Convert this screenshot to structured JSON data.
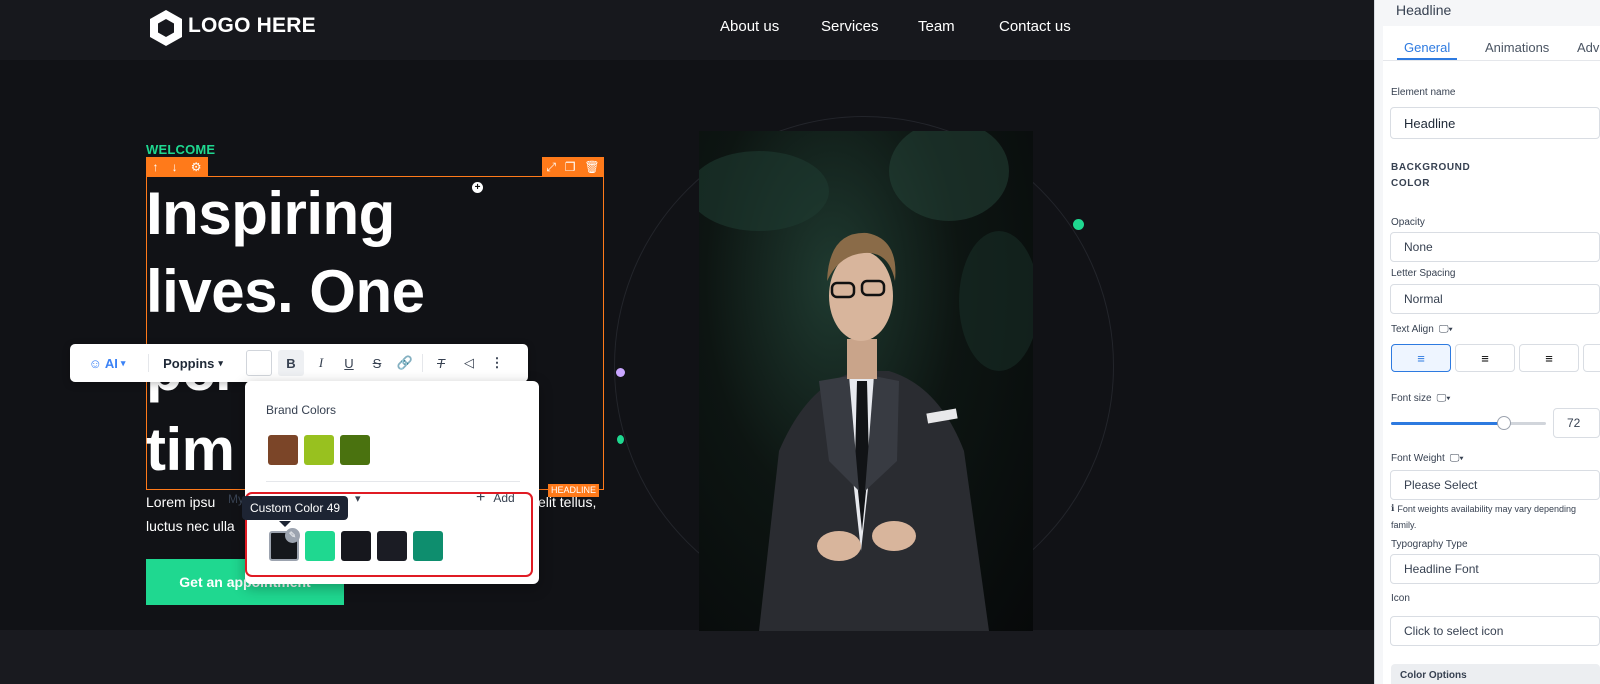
{
  "navbar": {
    "logo_text": "LOGO HERE",
    "links": [
      "About us",
      "Services",
      "Team",
      "Contact us"
    ]
  },
  "hero": {
    "welcome": "WELCOME",
    "headline_lines": [
      "Inspiring",
      "lives. One",
      "per",
      "tim"
    ],
    "element_tag": "HEADLINE",
    "lorem_line1_left": "Lorem ipsu",
    "lorem_line1_right": "elit tellus,",
    "lorem_line2": "luctus nec ulla",
    "cta_label": "Get an appointment"
  },
  "text_toolbar": {
    "ai_label": "AI",
    "font_label": "Poppins"
  },
  "color_popup": {
    "brand_heading": "Brand Colors",
    "brand_colors": [
      "#7b4528",
      "#98c11f",
      "#4a720f"
    ],
    "custom_label_partial": "My",
    "tooltip": "Custom Color 49",
    "add_label": "Add",
    "custom_colors": [
      "#15171c",
      "#1fd890",
      "#16171d",
      "#1b1c24",
      "#0e8e6e"
    ]
  },
  "panel": {
    "title": "Headline",
    "tabs": [
      "General",
      "Animations",
      "Adv"
    ],
    "active_tab": "General",
    "element_name_label": "Element name",
    "element_name_value": "Headline",
    "background_color_label": "BACKGROUND COLOR",
    "opacity_label": "Opacity",
    "opacity_value": "None",
    "letter_spacing_label": "Letter Spacing",
    "letter_spacing_value": "Normal",
    "text_align_label": "Text Align",
    "font_size_label": "Font size",
    "font_size_value": "72",
    "font_size_fraction": 0.73,
    "font_weight_label": "Font Weight",
    "font_weight_placeholder": "Please Select",
    "font_weight_note": "Font weights availability may vary depending",
    "font_weight_note2": "family.",
    "typography_label": "Typography Type",
    "typography_value": "Headline Font",
    "icon_label": "Icon",
    "icon_placeholder": "Click to select icon",
    "color_options_label": "Color Options"
  },
  "colors": {
    "accent_green": "#1fd890",
    "selection_orange": "#ff7a1a",
    "panel_blue": "#2d7ae0",
    "highlight_red": "#e01b24"
  }
}
